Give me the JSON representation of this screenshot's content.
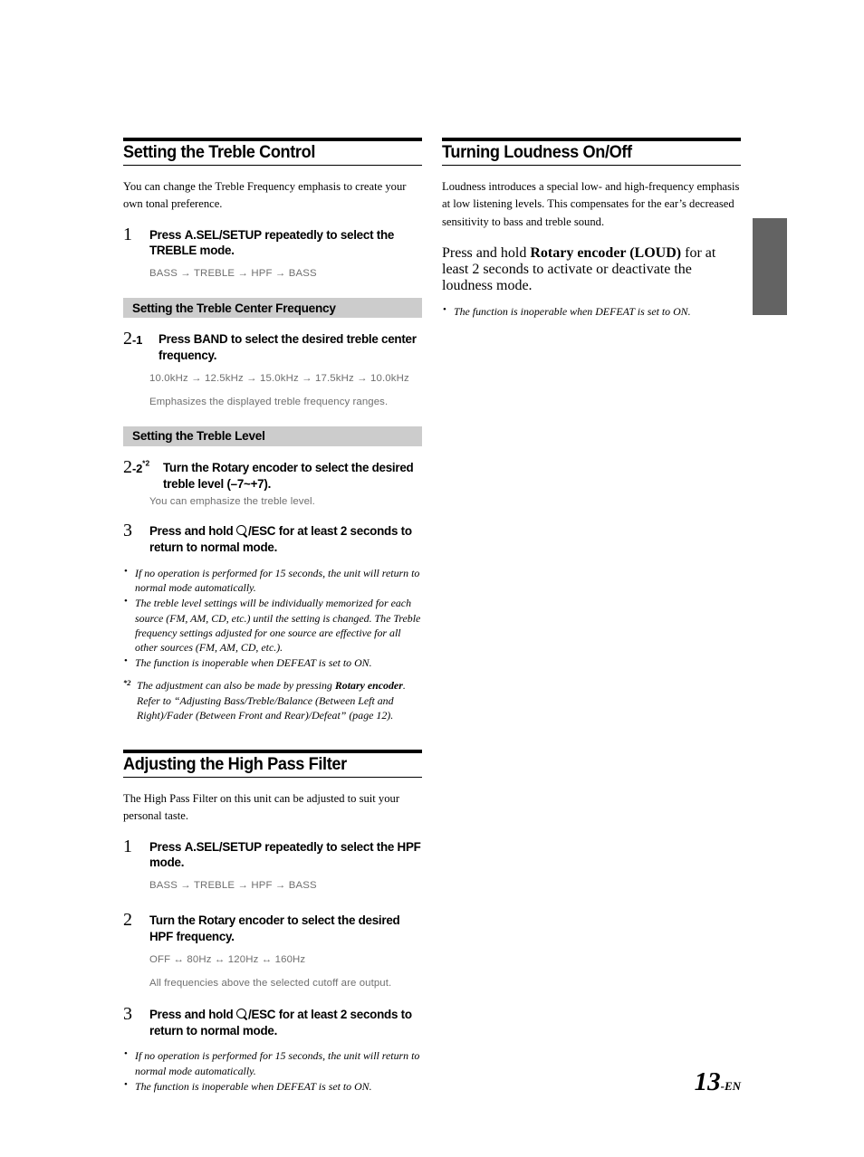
{
  "page": {
    "number": "13",
    "number_suffix": "-EN"
  },
  "left_column": {
    "section1": {
      "heading": "Setting the Treble Control",
      "intro": "You can change the Treble Frequency emphasis to create your own tonal preference.",
      "step1": {
        "number": "1",
        "instruction_pre": "Press ",
        "instruction_bold": "A.SEL/SETUP",
        "instruction_post": " repeatedly to select the TREBLE mode.",
        "flow": "BASS → TREBLE → HPF → BASS"
      },
      "subheading_freq": "Setting the Treble Center Frequency",
      "step2_1": {
        "number": "2",
        "number_sub": "-1",
        "instruction_pre": "Press ",
        "instruction_bold": "BAND",
        "instruction_post": " to select the desired treble center frequency.",
        "flow": "10.0kHz → 12.5kHz → 15.0kHz → 17.5kHz → 10.0kHz",
        "description": "Emphasizes the displayed treble frequency ranges."
      },
      "subheading_level": "Setting the Treble Level",
      "step2_2": {
        "number": "2",
        "number_sub": "-2",
        "number_sup": "*2",
        "instruction_pre": "Turn the ",
        "instruction_bold": "Rotary encoder",
        "instruction_post": " to select the desired treble level (–7~+7).",
        "description": "You can emphasize the treble level."
      },
      "step3": {
        "number": "3",
        "instruction_pre": "Press and hold ",
        "icon": "magnifier-icon",
        "instruction_bold": "/ESC",
        "instruction_post": " for at least 2 seconds to return to normal mode."
      },
      "notes": [
        "If no operation is performed for 15 seconds, the unit will return to normal mode automatically.",
        "The treble level settings will be individually memorized for each source (FM, AM, CD, etc.) until the setting is changed. The Treble frequency settings adjusted for one source are effective for all other sources (FM, AM, CD, etc.).",
        "The function is inoperable when DEFEAT is set to ON."
      ],
      "footnote": {
        "mark": "*2",
        "text_pre": "The adjustment can also be made by pressing ",
        "text_bold": "Rotary encoder",
        "text_post": ". Refer to “Adjusting Bass/Treble/Balance (Between Left and Right)/Fader (Between Front and Rear)/Defeat” (page 12)."
      }
    },
    "section2": {
      "heading": "Adjusting the High Pass Filter",
      "intro": "The High Pass Filter on this unit can be adjusted to suit your personal taste.",
      "step1": {
        "number": "1",
        "instruction_pre": "Press ",
        "instruction_bold": "A.SEL/SETUP",
        "instruction_post": " repeatedly to select the HPF mode.",
        "flow": "BASS → TREBLE → HPF → BASS"
      },
      "step2": {
        "number": "2",
        "instruction_pre": "Turn the ",
        "instruction_bold": "Rotary encoder",
        "instruction_post": " to select the desired HPF frequency.",
        "flow": "OFF ↔ 80Hz ↔ 120Hz ↔ 160Hz",
        "description": "All frequencies above the selected cutoff are output."
      },
      "step3": {
        "number": "3",
        "instruction_pre": "Press and hold ",
        "icon": "magnifier-icon",
        "instruction_bold": "/ESC",
        "instruction_post": " for at least 2 seconds to return to normal mode."
      },
      "notes": [
        "If no operation is performed for 15 seconds, the unit will return to normal mode automatically.",
        "The function is inoperable when DEFEAT is set to ON."
      ]
    }
  },
  "right_column": {
    "section1": {
      "heading": "Turning Loudness On/Off",
      "intro": "Loudness introduces a special low- and high-frequency emphasis at low listening levels. This compensates for the ear’s decreased sensitivity to bass and treble sound.",
      "instruction": {
        "pre": "Press and hold ",
        "bold": "Rotary encoder (LOUD)",
        "post": " for at least 2 seconds to activate or deactivate the loudness mode."
      },
      "notes": [
        "The function is inoperable when DEFEAT is set to ON."
      ]
    }
  },
  "colors": {
    "subbar_background": "#cccccc",
    "edge_tab": "#636363",
    "gray_text": "#6f6f6f"
  }
}
